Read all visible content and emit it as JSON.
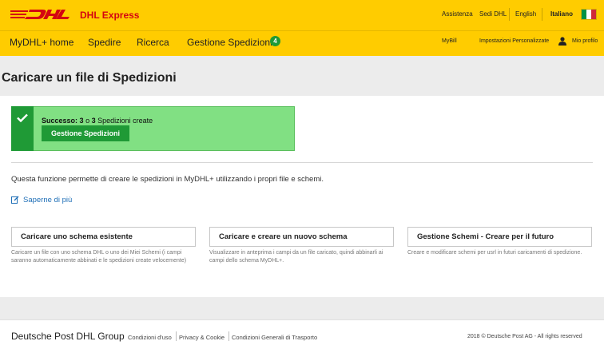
{
  "header": {
    "brand": "DHL Express",
    "links": {
      "assistenza": "Assistenza",
      "sedi": "Sedi DHL",
      "english": "English",
      "italiano": "Italiano"
    },
    "flag_colors": [
      "#009246",
      "#ffffff",
      "#ce2b37"
    ]
  },
  "nav": {
    "items": [
      {
        "label": "MyDHL+ home"
      },
      {
        "label": "Spedire"
      },
      {
        "label": "Ricerca"
      },
      {
        "label": "Gestione Spedizioni"
      }
    ],
    "badge": "4",
    "right": {
      "mybill": "MyBill",
      "impostazioni": "Impostazioni Personalizzate",
      "profilo": "Mio profilo"
    }
  },
  "page": {
    "title": "Caricare un file di Spedizioni"
  },
  "success": {
    "label": "Successo:",
    "count": "3",
    "of": "o",
    "total": "3",
    "suffix": "Spedizioni create",
    "button": "Gestione Spedizioni"
  },
  "main": {
    "intro": "Questa funzione permette di creare le spedizioni in MyDHL+ utilizzando i propri file e schemi.",
    "learn_more": "Saperne di più",
    "options": [
      {
        "label": "Caricare uno schema esistente",
        "desc": "Caricare un file con uno schema DHL o uno dei Miei Schemi (i campi saranno automaticamente abbinati e le spedizioni create velocemente)"
      },
      {
        "label": "Caricare e creare un nuovo schema",
        "desc": "Visualizzare in anteprima i campi da un file caricato, quindi abbinarli ai campi dello schema MyDHL+."
      },
      {
        "label": "Gestione Schemi - Creare per il futuro",
        "desc": "Creare e modificare schemi per usrl in futuri caricamenti di spedizione."
      }
    ]
  },
  "footer": {
    "brand": "Deutsche Post DHL Group",
    "links": [
      "Condizioni d'uso",
      "Privacy & Cookie",
      "Condizioni Generali di Trasporto"
    ],
    "copyright": "2018 © Deutsche Post AG - All rights reserved"
  },
  "colors": {
    "dhl_yellow": "#ffcc00",
    "dhl_red": "#d40511",
    "success_green": "#1f9a36",
    "success_bg": "#81e083",
    "link_blue": "#1f6fb7"
  }
}
